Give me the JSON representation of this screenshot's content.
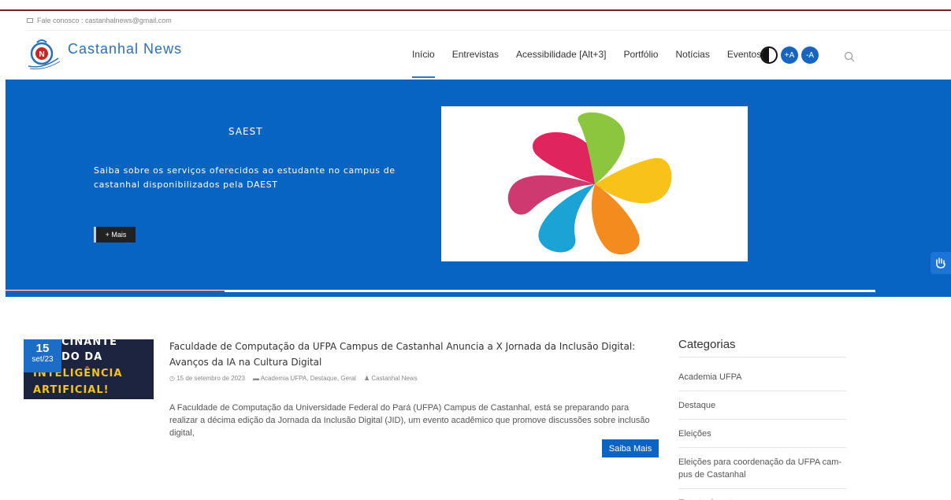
{
  "topbar": {
    "contact": "Fale conosco : castanhalnews@gmail.com"
  },
  "logo": {
    "text": "Castanhal News"
  },
  "nav": {
    "items": [
      "Início",
      "Entrevistas",
      "Acessibilidade [Alt+3]",
      "Portfólio",
      "Notícias",
      "Eventos"
    ],
    "font_increase": "+A",
    "font_decrease": "-A"
  },
  "hero": {
    "title": "SAEST",
    "text": "Saiba sobre os serviços oferecidos ao estudante no campus de castanhal disponibilizados pela DAEST",
    "button": "+ Mais"
  },
  "post": {
    "date_day": "15",
    "date_month": "set/23",
    "thumb_lines": [
      "CINANTE",
      "DO DA",
      "INTELIGÊNCIA",
      "ARTIFICIAL!"
    ],
    "title": "Faculdade de Computação da UFPA Campus de Castanhal Anuncia a X Jornada da Inclusão Digital: Avanços da IA na Cultura Digital",
    "meta_date": "15 de setembro de 2023",
    "meta_categories": "Academia UFPA, Destaque, Geral",
    "meta_author": "Castanhal News",
    "excerpt": "A Faculdade de Computação da Universidade Federal do Pará (UFPA) Campus de Castanhal, está se preparando para realizar a décima edição da Jornada da Inclusão Digital (JID), um evento acadêmico que promove discussões sobre inclusão digital,",
    "button": "Saiba Mais"
  },
  "sidebar": {
    "title": "Categorias",
    "categories": [
      "Academia UFPA",
      "Destaque",
      "Eleições",
      "Eleições para coordenação da UFPA cam-pus de Castanhal",
      "Entretenimento"
    ]
  },
  "colors": {
    "primary": "#0864c2",
    "dark_red": "#7a1f1f",
    "logo_blue": "#2e6fb0"
  },
  "icons": [
    "mail-icon",
    "logo-icon",
    "contrast-icon",
    "search-icon",
    "sign-language-icon",
    "clock-icon",
    "folder-icon",
    "user-icon"
  ]
}
